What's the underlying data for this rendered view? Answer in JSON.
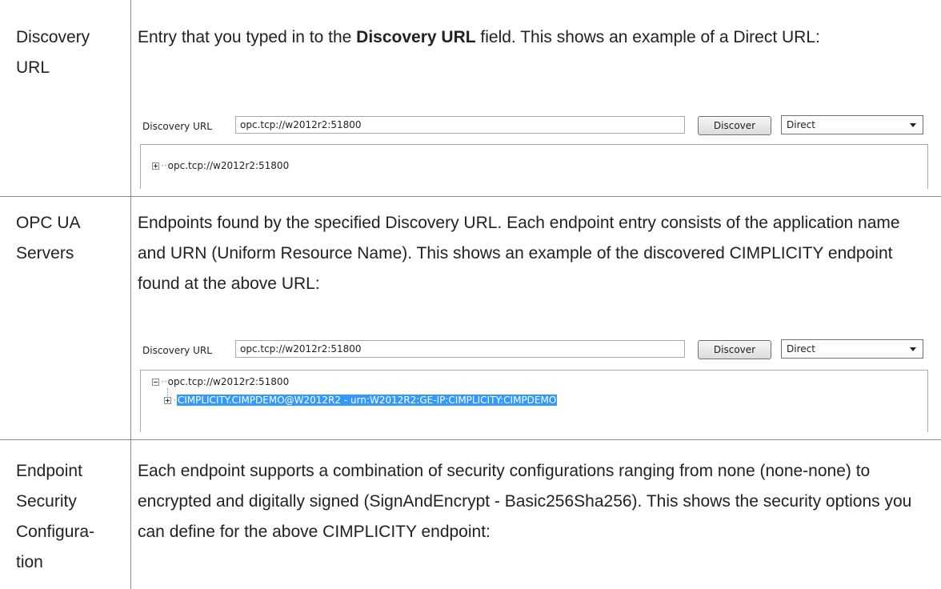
{
  "rows": [
    {
      "term_lines": [
        "Discovery",
        "URL"
      ],
      "desc_pre": "Entry that you typed in to the ",
      "desc_bold": "Discovery URL",
      "desc_post": " field. This shows an example of a Direct URL:"
    },
    {
      "term_lines": [
        "OPC UA",
        "Servers"
      ],
      "desc": "Endpoints found by the specified Discovery URL. Each endpoint entry consists of the application name and URN (Uniform Resource Name). This shows an example of the discovered CIMPLICITY endpoint found at the above URL:"
    },
    {
      "term_lines": [
        "Endpoint",
        "Security",
        "Configura-",
        "tion"
      ],
      "desc": "Each endpoint supports a combination of security configurations ranging from none (none-none) to encrypted and digitally signed (SignAndEncrypt - Basic256Sha256). This shows the security options you can define for the above CIMPLICITY endpoint:"
    }
  ],
  "dialog": {
    "label": "Discovery URL",
    "url_value": "opc.tcp://w2012r2:51800",
    "discover_label": "Discover",
    "mode_value": "Direct",
    "tree_root": "opc.tcp://w2012r2:51800",
    "tree_child": "CIMPLICITY.CIMPDEMO@W2012R2 - urn:W2012R2:GE-IP:CIMPLICITY:CIMPDEMO"
  }
}
